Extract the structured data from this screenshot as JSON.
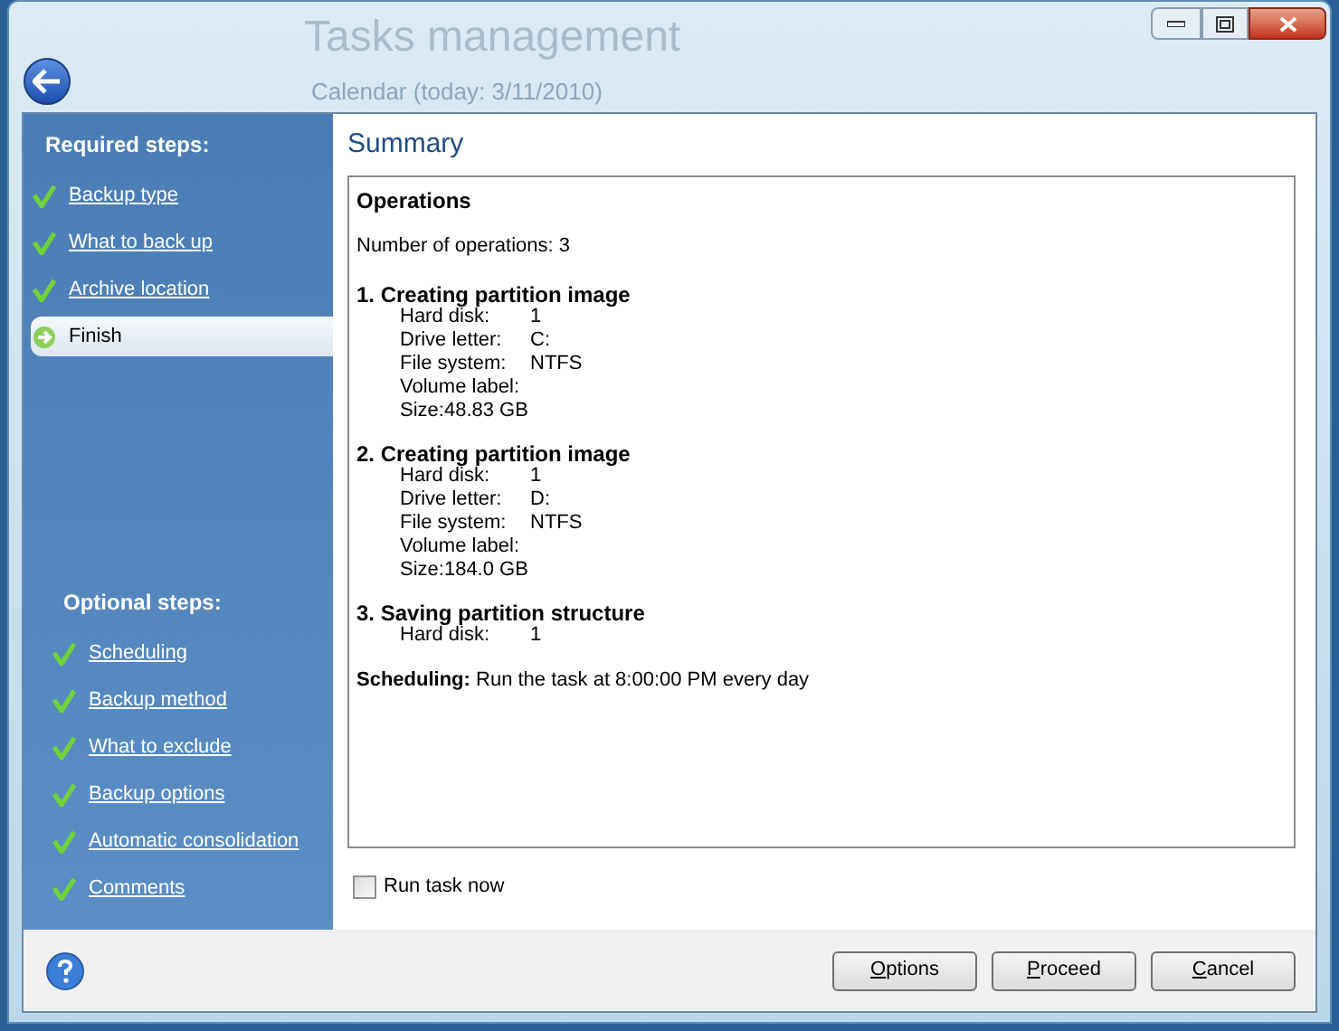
{
  "background": {
    "title": "Tasks management",
    "subtitle": "Calendar (today: 3/11/2010)"
  },
  "sidebar": {
    "sections": [
      {
        "heading": "Required steps:",
        "items": [
          {
            "label": "Backup type",
            "selected": false
          },
          {
            "label": "What to back up",
            "selected": false
          },
          {
            "label": "Archive location",
            "selected": false
          },
          {
            "label": "Finish",
            "selected": true
          }
        ]
      },
      {
        "heading": "Optional steps:",
        "items": [
          {
            "label": "Scheduling",
            "selected": false
          },
          {
            "label": "Backup method",
            "selected": false
          },
          {
            "label": "What to exclude",
            "selected": false
          },
          {
            "label": "Backup options",
            "selected": false
          },
          {
            "label": "Automatic consolidation",
            "selected": false
          },
          {
            "label": "Comments",
            "selected": false
          }
        ]
      }
    ]
  },
  "summary": {
    "title": "Summary",
    "heading": "Operations",
    "count_line": "Number of operations: 3",
    "operations": [
      {
        "title": "1. Creating partition image",
        "fields": [
          {
            "label": "Hard disk:",
            "value": "1",
            "kind": "column"
          },
          {
            "label": "Drive letter:",
            "value": "C:",
            "kind": "column"
          },
          {
            "label": "File system:",
            "value": "NTFS",
            "kind": "column"
          },
          {
            "label": "Volume label:",
            "kind": "column"
          },
          {
            "label": "Size:",
            "value": "48.83 GB",
            "kind": "inline"
          }
        ]
      },
      {
        "title": "2. Creating partition image",
        "fields": [
          {
            "label": "Hard disk:",
            "value": "1",
            "kind": "column"
          },
          {
            "label": "Drive letter:",
            "value": "D:",
            "kind": "column"
          },
          {
            "label": "File system:",
            "value": "NTFS",
            "kind": "column"
          },
          {
            "label": "Volume label:",
            "kind": "column"
          },
          {
            "label": "Size:",
            "value": "184.0 GB",
            "kind": "inline"
          }
        ]
      },
      {
        "title": "3. Saving partition structure",
        "fields": [
          {
            "label": "Hard disk:",
            "value": "1",
            "kind": "column"
          }
        ]
      }
    ],
    "scheduling": "**Scheduling:** Run the task at 8:00:00 PM every day"
  },
  "run_now": {
    "label": "Run task now",
    "checked": false
  },
  "buttons": [
    {
      "label": "Options"
    },
    {
      "label": "Proceed"
    },
    {
      "label": "Cancel"
    }
  ]
}
